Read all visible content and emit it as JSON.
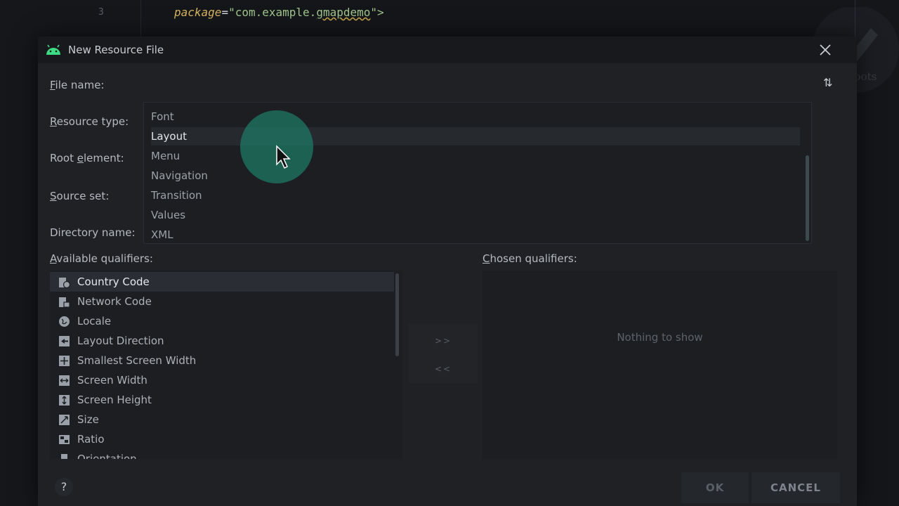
{
  "editor": {
    "line_number": "3",
    "code_attr": "package",
    "code_eq": "=",
    "code_str_a": "\"com.example.",
    "code_str_squiggle": "gmapdemo",
    "code_str_b": "\">"
  },
  "badge": {
    "text": "Next Roots"
  },
  "dialog": {
    "title": "New Resource File",
    "labels": {
      "file_name_first": "F",
      "file_name_rest": "ile name:",
      "resource_type_first": "R",
      "resource_type_rest": "esource type:",
      "root_element_a": "Root ",
      "root_element_u": "e",
      "root_element_b": "lement:",
      "source_set_first": "S",
      "source_set_rest": "ource set:",
      "directory_name": "Directory name:",
      "available_a": "A",
      "available_rest": "vailable qualifiers:",
      "chosen_a": "C",
      "chosen_rest": "hosen qualifiers:"
    },
    "resource_type_options": [
      "Font",
      "Layout",
      "Menu",
      "Navigation",
      "Transition",
      "Values",
      "XML"
    ],
    "resource_type_selected": "Layout",
    "available_qualifiers": [
      {
        "label": "Country Code",
        "icon": "country-code-icon"
      },
      {
        "label": "Network Code",
        "icon": "network-code-icon"
      },
      {
        "label": "Locale",
        "icon": "globe-icon"
      },
      {
        "label": "Layout Direction",
        "icon": "layout-direction-icon"
      },
      {
        "label": "Smallest Screen Width",
        "icon": "smallest-width-icon"
      },
      {
        "label": "Screen Width",
        "icon": "screen-width-icon"
      },
      {
        "label": "Screen Height",
        "icon": "screen-height-icon"
      },
      {
        "label": "Size",
        "icon": "size-icon"
      },
      {
        "label": "Ratio",
        "icon": "ratio-icon"
      },
      {
        "label": "Orientation",
        "icon": "orientation-icon"
      }
    ],
    "selected_qualifier": "Country Code",
    "move_right_label": ">>",
    "move_left_label": "<<",
    "chosen_empty": "Nothing to show",
    "help_label": "?",
    "ok_label": "OK",
    "cancel_label": "CANCEL"
  },
  "colors": {
    "accent_android": "#3ddc84",
    "cursor_halo": "#1e7864"
  }
}
